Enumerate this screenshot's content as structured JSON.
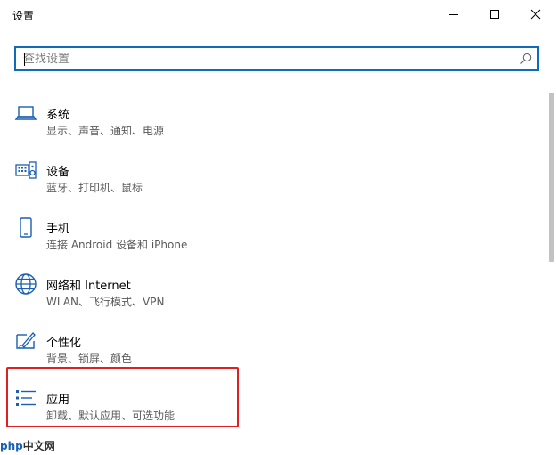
{
  "window": {
    "title": "设置"
  },
  "search": {
    "placeholder": "查找设置"
  },
  "items": [
    {
      "icon": "laptop-icon",
      "name": "系统",
      "desc": "显示、声音、通知、电源"
    },
    {
      "icon": "keyboard-speaker-icon",
      "name": "设备",
      "desc": "蓝牙、打印机、鼠标"
    },
    {
      "icon": "phone-icon",
      "name": "手机",
      "desc": "连接 Android 设备和 iPhone"
    },
    {
      "icon": "globe-icon",
      "name": "网络和 Internet",
      "desc": "WLAN、飞行模式、VPN"
    },
    {
      "icon": "personalization-icon",
      "name": "个性化",
      "desc": "背景、锁屏、颜色"
    },
    {
      "icon": "apps-list-icon",
      "name": "应用",
      "desc": "卸载、默认应用、可选功能"
    }
  ],
  "watermark": {
    "part1": "php",
    "part2": "中文网"
  },
  "colors": {
    "accent": "#0f6cbd",
    "highlight": "#e02020"
  }
}
